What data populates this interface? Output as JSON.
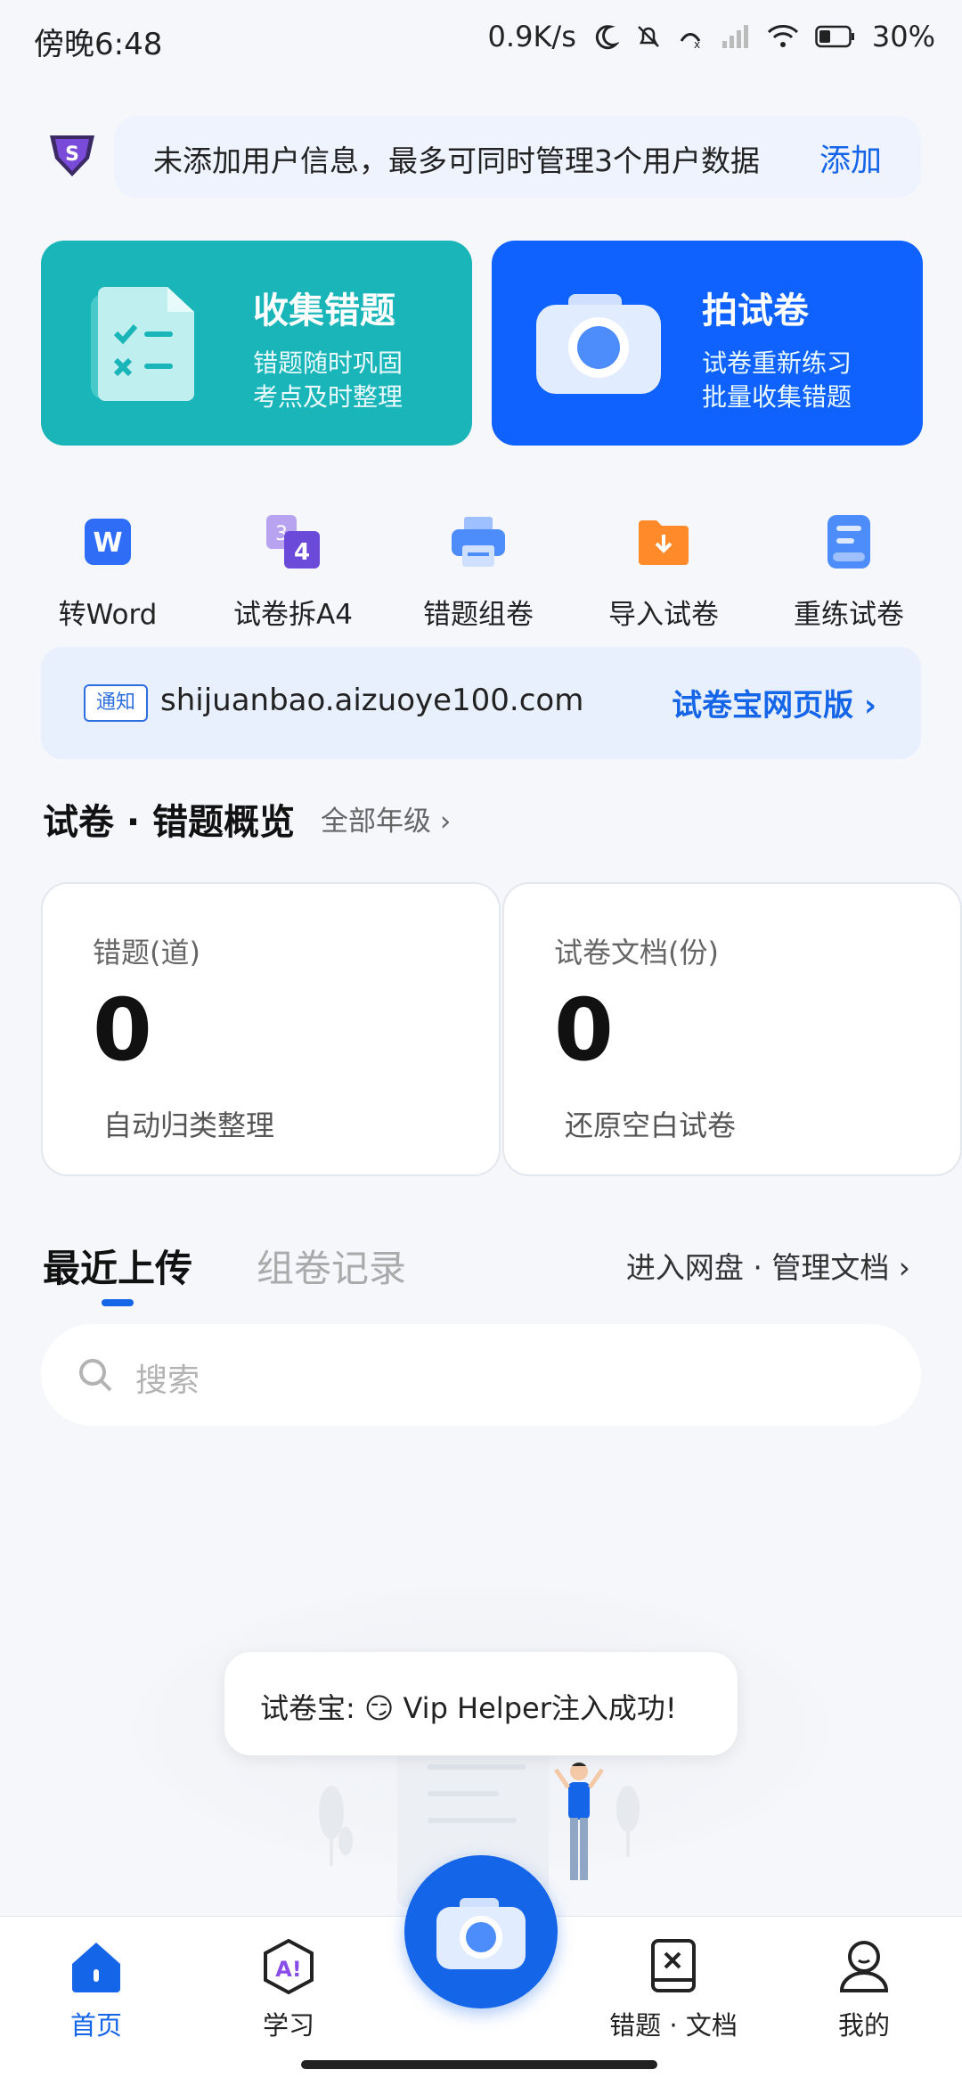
{
  "status_bar": {
    "time": "傍晚6:48",
    "speed": "0.9K/s",
    "battery": "30%"
  },
  "user_banner": {
    "text": "未添加用户信息，最多可同时管理3个用户数据",
    "action": "添加"
  },
  "cards": [
    {
      "title": "收集错题",
      "line1": "错题随时巩固",
      "line2": "考点及时整理",
      "icon": "checklist-icon"
    },
    {
      "title": "拍试卷",
      "line1": "试卷重新练习",
      "line2": "批量收集错题",
      "icon": "camera-icon"
    }
  ],
  "tools": [
    {
      "label": "转Word",
      "icon": "word-icon"
    },
    {
      "label": "试卷拆A4",
      "icon": "split-a4-icon"
    },
    {
      "label": "错题组卷",
      "icon": "printer-icon"
    },
    {
      "label": "导入试卷",
      "icon": "import-folder-icon"
    },
    {
      "label": "重练试卷",
      "icon": "redo-paper-icon"
    }
  ],
  "notice": {
    "tag": "通知",
    "url": "shijuanbao.aizuoye100.com",
    "link": "试卷宝网页版 ›"
  },
  "overview": {
    "title": "试卷 · 错题概览",
    "filter": "全部年级 ›",
    "stats": [
      {
        "label": "错题(道)",
        "value": "0",
        "desc": "自动归类整理"
      },
      {
        "label": "试卷文档(份)",
        "value": "0",
        "desc": "还原空白试卷"
      }
    ]
  },
  "tabs": {
    "active": "最近上传",
    "other": "组卷记录",
    "netdisk": "进入网盘 · 管理文档 ›"
  },
  "search": {
    "placeholder": "搜索"
  },
  "toast": {
    "text": "试卷宝:  😏 Vip Helper注入成功!"
  },
  "bottom_nav": [
    {
      "label": "首页",
      "icon": "home-icon",
      "active": true
    },
    {
      "label": "学习",
      "icon": "ai-learn-icon",
      "active": false
    },
    {
      "label": "错题 · 文档",
      "icon": "mistake-book-icon",
      "active": false
    },
    {
      "label": "我的",
      "icon": "profile-icon",
      "active": false
    }
  ],
  "colors": {
    "accent": "#1565e8",
    "teal": "#19b5b8",
    "blue_card": "#0f62fe"
  }
}
